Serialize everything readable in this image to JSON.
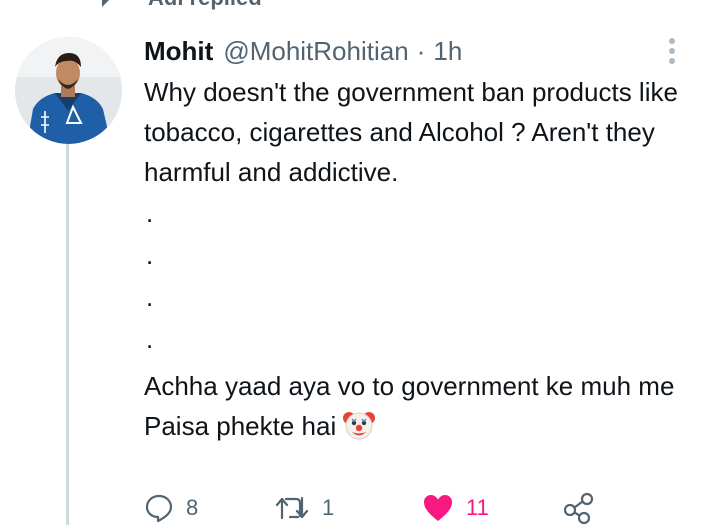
{
  "context": {
    "text": "Adi replied"
  },
  "tweet": {
    "author_name": "Mohit",
    "handle": "@MohitRohitian",
    "separator": "·",
    "time": "1h",
    "paragraph1": "Why doesn't the government ban products like tobacco, cigarettes and Alcohol ? Aren't they harmful and addictive.",
    "dots": [
      ".",
      ".",
      ".",
      "."
    ],
    "paragraph2": "Achha yaad aya vo to government ke muh me Paisa phekte hai"
  },
  "actions": {
    "reply_count": "8",
    "retweet_count": "1",
    "like_count": "11"
  },
  "colors": {
    "like_active": "#f91880",
    "muted": "#536471",
    "thread_line": "#cfd9de"
  },
  "icons": [
    "reply-icon",
    "retweet-icon",
    "heart-icon",
    "share-icon",
    "more-icon",
    "clown-face-emoji",
    "avatar"
  ]
}
